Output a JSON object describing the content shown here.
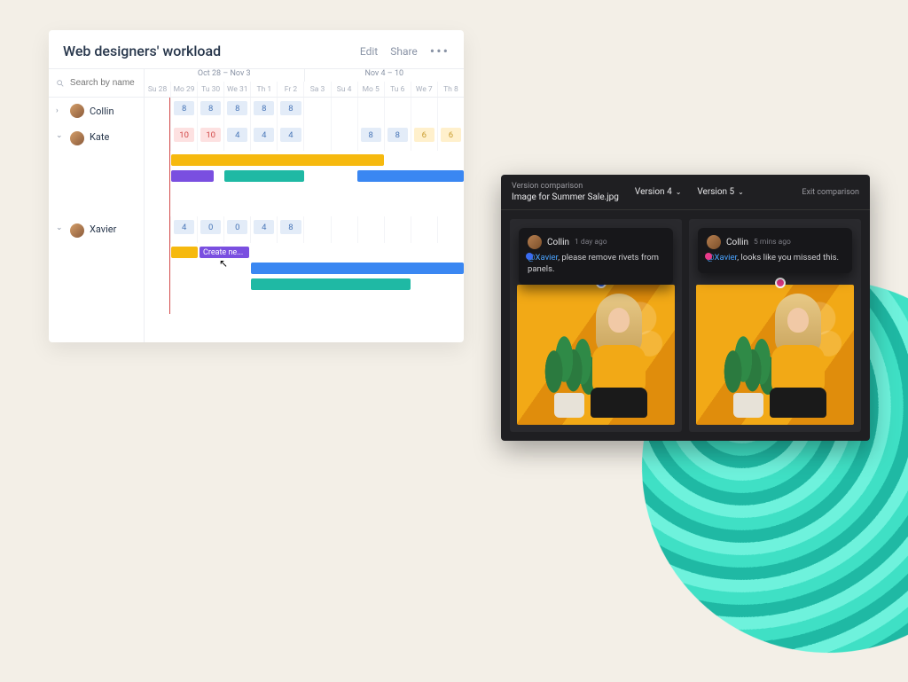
{
  "workload": {
    "title": "Web designers' workload",
    "edit": "Edit",
    "share": "Share",
    "search_placeholder": "Search by name",
    "week_ranges": [
      "Oct 28 – Nov 3",
      "Nov 4 – 10"
    ],
    "days": [
      "Su 28",
      "Mo 29",
      "Tu 30",
      "We 31",
      "Th 1",
      "Fr 2",
      "Sa 3",
      "Su 4",
      "Mo 5",
      "Tu 6",
      "We 7",
      "Th 8"
    ],
    "users": [
      {
        "name": "Collin",
        "expanded": false,
        "hours": [
          "",
          "8",
          "8",
          "8",
          "8",
          "8",
          "",
          "",
          "",
          "",
          "",
          ""
        ]
      },
      {
        "name": "Kate",
        "expanded": true,
        "hours": [
          "",
          "10",
          "10",
          "4",
          "4",
          "4",
          "",
          "",
          "8",
          "8",
          "6",
          "6"
        ]
      },
      {
        "name": "Xavier",
        "expanded": true,
        "hours": [
          "",
          "4",
          "0",
          "0",
          "4",
          "8",
          "",
          "",
          "",
          "",
          "",
          ""
        ]
      }
    ],
    "create_label": "Create ne..."
  },
  "vc": {
    "title": "Version comparison",
    "file": "Image for Summer Sale.jpg",
    "version_left": "Version 4",
    "version_right": "Version 5",
    "exit": "Exit comparison",
    "comments": [
      {
        "author": "Collin",
        "time": "1 day ago",
        "mention": "@Xavier",
        "text": ", please remove rivets from panels."
      },
      {
        "author": "Collin",
        "time": "5 mins ago",
        "mention": "@Xavier",
        "text": ", looks like you missed this."
      }
    ]
  }
}
